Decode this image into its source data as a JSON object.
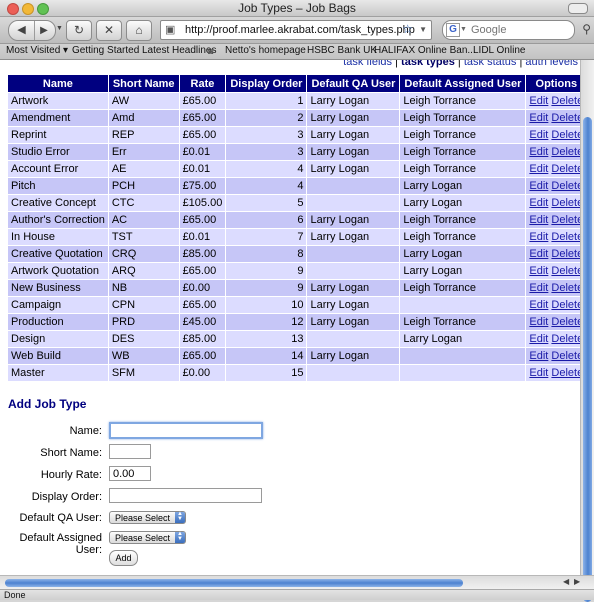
{
  "window": {
    "title": "Job Types – Job Bags"
  },
  "toolbar": {
    "url": "http://proof.marlee.akrabat.com/task_types.php",
    "search_placeholder": "Google"
  },
  "bookmarks": [
    {
      "label": "Most Visited ▾"
    },
    {
      "label": "Getting Started"
    },
    {
      "label": "Latest Headlines"
    },
    {
      "label": "Netto's homepage"
    },
    {
      "label": "HSBC Bank UK"
    },
    {
      "label": "HALIFAX Online Ban..."
    },
    {
      "label": "LIDL Online"
    }
  ],
  "nav_links": {
    "task_fields": "task fields",
    "task_types": "task types",
    "task_status": "task status",
    "auth_levels": "auth levels",
    "sep": "|"
  },
  "table": {
    "headers": [
      "Name",
      "Short Name",
      "Rate",
      "Display Order",
      "Default QA User",
      "Default Assigned User",
      "Options"
    ],
    "edit_label": "Edit",
    "delete_label": "Delete",
    "rows": [
      {
        "name": "Artwork",
        "short": "AW",
        "rate": "£65.00",
        "order": "1",
        "qa": "Larry Logan",
        "assigned": "Leigh Torrance"
      },
      {
        "name": "Amendment",
        "short": "Amd",
        "rate": "£65.00",
        "order": "2",
        "qa": "Larry Logan",
        "assigned": "Leigh Torrance"
      },
      {
        "name": "Reprint",
        "short": "REP",
        "rate": "£65.00",
        "order": "3",
        "qa": "Larry Logan",
        "assigned": "Leigh Torrance"
      },
      {
        "name": "Studio Error",
        "short": "Err",
        "rate": "£0.01",
        "order": "3",
        "qa": "Larry Logan",
        "assigned": "Leigh Torrance"
      },
      {
        "name": "Account Error",
        "short": "AE",
        "rate": "£0.01",
        "order": "4",
        "qa": "Larry Logan",
        "assigned": "Leigh Torrance"
      },
      {
        "name": "Pitch",
        "short": "PCH",
        "rate": "£75.00",
        "order": "4",
        "qa": "",
        "assigned": "Larry Logan"
      },
      {
        "name": "Creative Concept",
        "short": "CTC",
        "rate": "£105.00",
        "order": "5",
        "qa": "",
        "assigned": "Larry Logan"
      },
      {
        "name": "Author's Correction",
        "short": "AC",
        "rate": "£65.00",
        "order": "6",
        "qa": "Larry Logan",
        "assigned": "Leigh Torrance"
      },
      {
        "name": "In House",
        "short": "TST",
        "rate": "£0.01",
        "order": "7",
        "qa": "Larry Logan",
        "assigned": "Leigh Torrance"
      },
      {
        "name": "Creative Quotation",
        "short": "CRQ",
        "rate": "£85.00",
        "order": "8",
        "qa": "",
        "assigned": "Larry Logan"
      },
      {
        "name": "Artwork Quotation",
        "short": "ARQ",
        "rate": "£65.00",
        "order": "9",
        "qa": "",
        "assigned": "Larry Logan"
      },
      {
        "name": "New Business",
        "short": "NB",
        "rate": "£0.00",
        "order": "9",
        "qa": "Larry Logan",
        "assigned": "Leigh Torrance"
      },
      {
        "name": "Campaign",
        "short": "CPN",
        "rate": "£65.00",
        "order": "10",
        "qa": "Larry Logan",
        "assigned": ""
      },
      {
        "name": "Production",
        "short": "PRD",
        "rate": "£45.00",
        "order": "12",
        "qa": "Larry Logan",
        "assigned": "Leigh Torrance"
      },
      {
        "name": "Design",
        "short": "DES",
        "rate": "£85.00",
        "order": "13",
        "qa": "",
        "assigned": "Larry Logan"
      },
      {
        "name": "Web Build",
        "short": "WB",
        "rate": "£65.00",
        "order": "14",
        "qa": "Larry Logan",
        "assigned": ""
      },
      {
        "name": "Master",
        "short": "SFM",
        "rate": "£0.00",
        "order": "15",
        "qa": "",
        "assigned": ""
      }
    ]
  },
  "form": {
    "title": "Add Job Type",
    "name_label": "Name:",
    "name_value": "",
    "short_label": "Short Name:",
    "short_value": "",
    "rate_label": "Hourly Rate:",
    "rate_value": "0.00",
    "order_label": "Display Order:",
    "order_value": "",
    "qa_label": "Default QA User:",
    "qa_value": "Please Select",
    "assigned_label": "Default Assigned User:",
    "assigned_value": "Please Select",
    "add_label": "Add"
  },
  "status": {
    "text": "Done"
  },
  "colors": {
    "header_bg": "#000080",
    "row_light": "#dcdcff",
    "row_dark": "#c6c6f7",
    "link": "#1a1aa8"
  }
}
